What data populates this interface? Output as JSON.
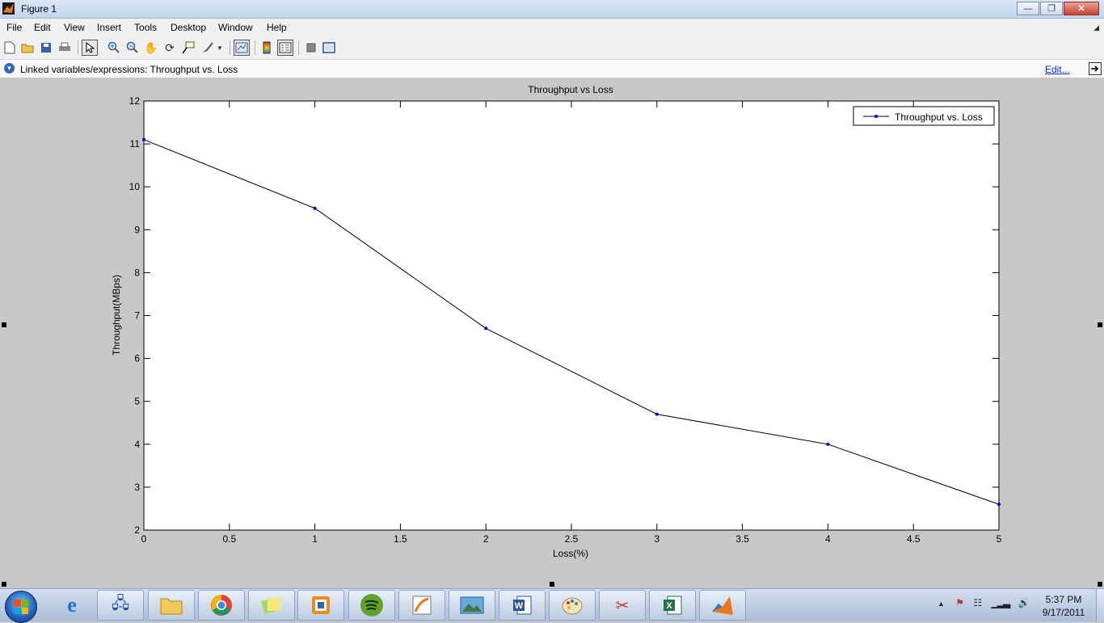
{
  "window": {
    "title": "Figure 1",
    "controls": [
      "minimize",
      "restore",
      "close"
    ]
  },
  "menubar": {
    "items": [
      "File",
      "Edit",
      "View",
      "Insert",
      "Tools",
      "Desktop",
      "Window",
      "Help"
    ]
  },
  "toolbar": {
    "buttons": [
      "new-figure",
      "open-file",
      "save",
      "print",
      "edit-plot",
      "zoom-in",
      "zoom-out",
      "pan",
      "rotate-3d",
      "data-cursor",
      "brush",
      "link-plot",
      "insert-colorbar",
      "insert-legend",
      "hide-plot-tools",
      "show-plot-tools"
    ],
    "active": "edit-plot"
  },
  "linked": {
    "text": "Linked variables/expressions: Throughput vs. Loss",
    "edit_label": "Edit..."
  },
  "chart_data": {
    "type": "line",
    "title": "Throughput vs Loss",
    "xlabel": "Loss(%)",
    "ylabel": "Throughput(MBps)",
    "xlim": [
      0,
      5
    ],
    "ylim": [
      2,
      12
    ],
    "xticks": [
      "0",
      "0.5",
      "1",
      "1.5",
      "2",
      "2.5",
      "3",
      "3.5",
      "4",
      "4.5",
      "5"
    ],
    "yticks": [
      "2",
      "3",
      "4",
      "5",
      "6",
      "7",
      "8",
      "9",
      "10",
      "11",
      "12"
    ],
    "grid": false,
    "legend_position": "top-right",
    "series": [
      {
        "name": "Throughput vs. Loss",
        "x": [
          0,
          1,
          2,
          3,
          4,
          5
        ],
        "y": [
          11.1,
          9.5,
          6.7,
          4.7,
          4.0,
          2.6
        ],
        "color": "#0000cc",
        "marker": "dot"
      }
    ]
  },
  "taskbar": {
    "apps": [
      "internet-explorer",
      "network-connection",
      "windows-explorer",
      "google-chrome",
      "sticky-notes",
      "vmware",
      "spotify",
      "matlab-editor",
      "photo-viewer",
      "microsoft-word",
      "paint",
      "snipping-tool",
      "microsoft-excel",
      "matlab"
    ],
    "clock_time": "5:37 PM",
    "clock_date": "9/17/2011"
  }
}
